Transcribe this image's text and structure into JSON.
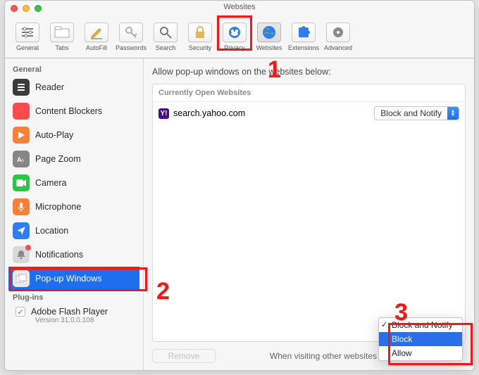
{
  "window": {
    "title_small": "",
    "title": "Websites"
  },
  "toolbar": [
    {
      "id": "general",
      "label": "General",
      "icon": "slider",
      "color": "#7a7a7a"
    },
    {
      "id": "tabs",
      "label": "Tabs",
      "icon": "tabs",
      "color": "#7a7a7a"
    },
    {
      "id": "autofill",
      "label": "AutoFill",
      "icon": "pencil",
      "color": "#d9a83d"
    },
    {
      "id": "passwords",
      "label": "Passwords",
      "icon": "key",
      "color": "#b0b0b0"
    },
    {
      "id": "search",
      "label": "Search",
      "icon": "search",
      "color": "#7a7a7a"
    },
    {
      "id": "security",
      "label": "Security",
      "icon": "lock",
      "color": "#e1b84d"
    },
    {
      "id": "privacy",
      "label": "Privacy",
      "icon": "privacy",
      "color": "#2e7df2"
    },
    {
      "id": "websites",
      "label": "Websites",
      "icon": "globe",
      "color": "#2e7df2",
      "active": true
    },
    {
      "id": "extensions",
      "label": "Extensions",
      "icon": "puzzle",
      "color": "#2e7df2"
    },
    {
      "id": "advanced",
      "label": "Advanced",
      "icon": "gear",
      "color": "#8a8a8a"
    }
  ],
  "sidebar": {
    "sections": [
      {
        "header": "General",
        "items": [
          {
            "id": "reader",
            "label": "Reader",
            "icon_bg": "#3b3b3b",
            "svg": "reader"
          },
          {
            "id": "content-blk",
            "label": "Content Blockers",
            "icon_bg": "#ff4b4b",
            "svg": "stop"
          },
          {
            "id": "autoplay",
            "label": "Auto-Play",
            "icon_bg": "#ff7f34",
            "svg": "play"
          },
          {
            "id": "pagezoom",
            "label": "Page Zoom",
            "icon_bg": "#868686",
            "svg": "zoom"
          },
          {
            "id": "camera",
            "label": "Camera",
            "icon_bg": "#28c840",
            "svg": "camera"
          },
          {
            "id": "microphone",
            "label": "Microphone",
            "icon_bg": "#ff7f34",
            "svg": "mic"
          },
          {
            "id": "location",
            "label": "Location",
            "icon_bg": "#2e7df2",
            "svg": "location"
          },
          {
            "id": "notifications",
            "label": "Notifications",
            "icon_bg": "#d9d9d9",
            "svg": "bell",
            "badge": true
          },
          {
            "id": "popups",
            "label": "Pop-up Windows",
            "icon_bg": "#eaeaea",
            "svg": "popup",
            "active": true
          }
        ]
      },
      {
        "header": "Plug-ins",
        "items": [
          {
            "id": "flash",
            "label": "Adobe Flash Player",
            "sub": "Version 31.0.0.108",
            "checkbox": true
          }
        ]
      }
    ]
  },
  "main": {
    "heading": "Allow pop-up windows on the websites below:",
    "open_header": "Currently Open Websites",
    "sites": [
      {
        "domain": "search.yahoo.com",
        "select_label": "Block and Notify"
      }
    ],
    "remove_label": "Remove",
    "other_label": "When visiting other websites",
    "dropdown": {
      "prev_selected": "Block and Notify",
      "highlighted": "Block",
      "options": [
        "Block and Notify",
        "Block",
        "Allow"
      ]
    }
  },
  "annot": {
    "n1": "1",
    "n2": "2",
    "n3": "3"
  }
}
